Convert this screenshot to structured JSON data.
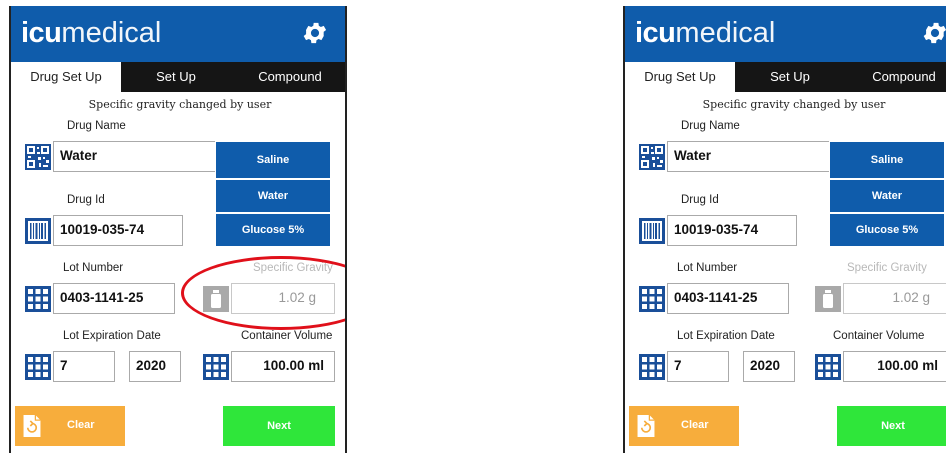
{
  "brand": {
    "bold": "icu",
    "light": "medical"
  },
  "tabs": [
    "Drug Set Up",
    "Set Up",
    "Compound"
  ],
  "note": "Specific gravity changed by user",
  "labels": {
    "drug_name": "Drug Name",
    "drug_id": "Drug Id",
    "lot_number": "Lot Number",
    "specific_gravity": "Specific Gravity",
    "lot_expiration": "Lot Expiration Date",
    "container_volume": "Container Volume"
  },
  "values": {
    "drug_name": "Water",
    "drug_id": "10019-035-74",
    "lot_number": "0403-1141-25",
    "specific_gravity": "1.02 g",
    "exp_month": "7",
    "exp_year": "2020",
    "container_volume": "100.00 ml"
  },
  "drug_buttons": [
    "Saline",
    "Water",
    "Glucose 5%"
  ],
  "actions": {
    "clear": "Clear",
    "next": "Next"
  },
  "colors": {
    "brand_blue": "#0f5cab",
    "clear_orange": "#f7ad3c",
    "next_green": "#2fe63a",
    "highlight_red": "#e0101a"
  },
  "icons": [
    "gear-icon",
    "qr-code-icon",
    "barcode-icon",
    "grid-icon",
    "bottle-icon",
    "clear-icon"
  ]
}
